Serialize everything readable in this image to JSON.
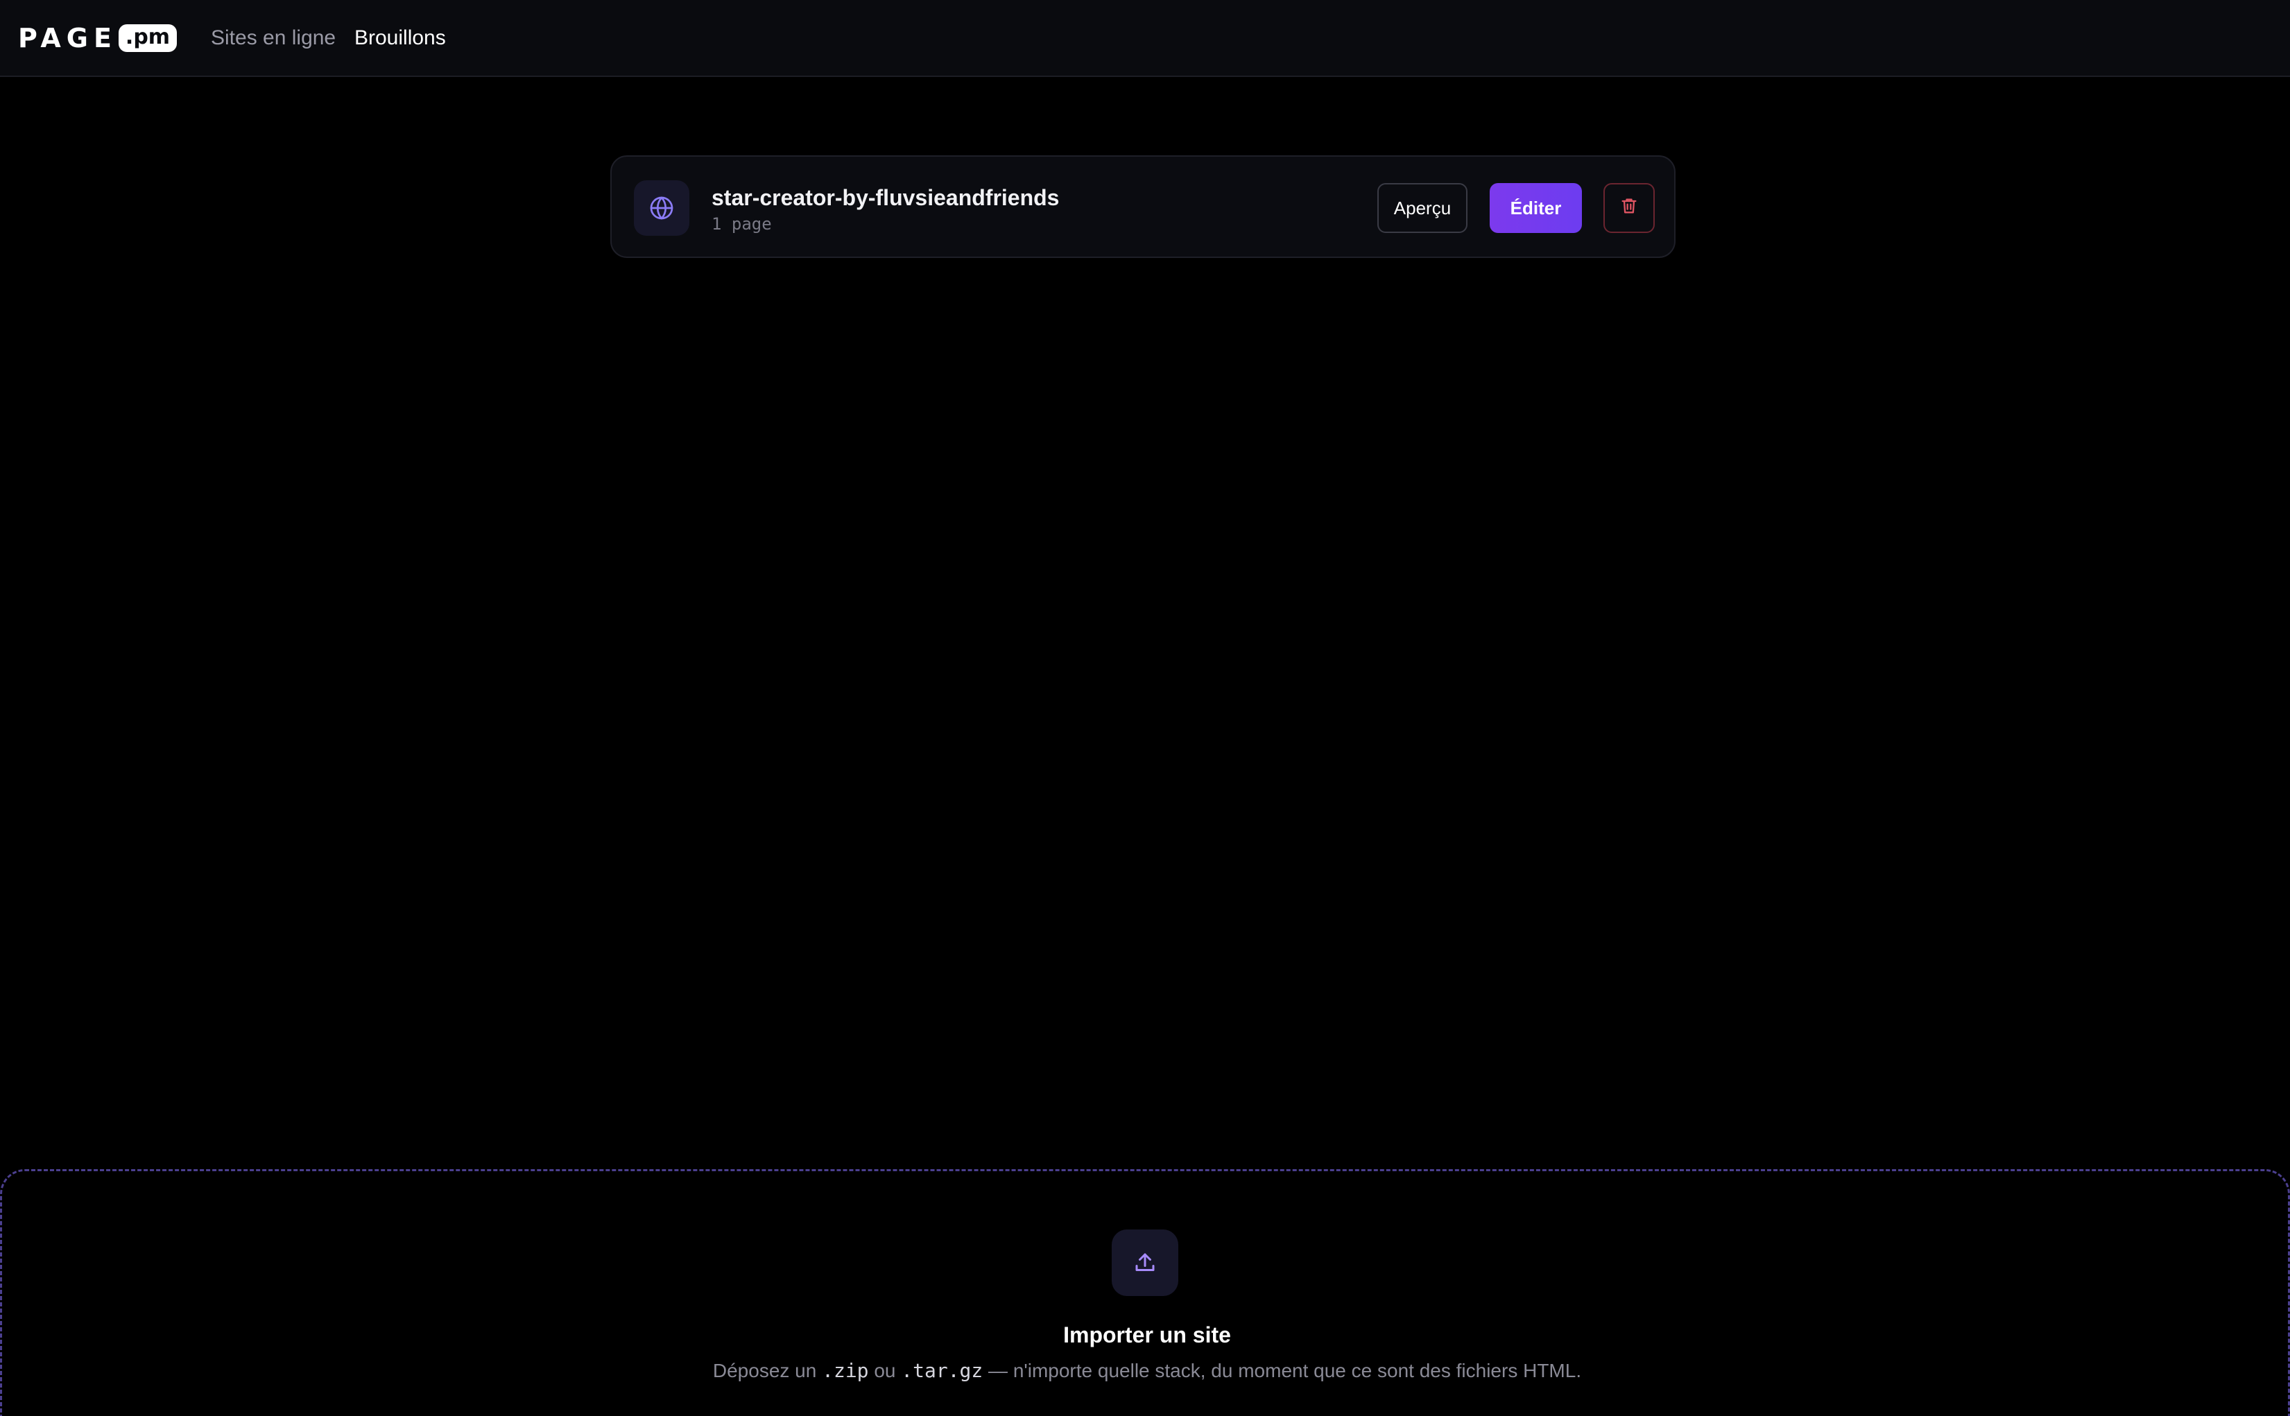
{
  "header": {
    "logo_word": "PAGE",
    "logo_badge": ".pm",
    "nav": [
      {
        "label": "Sites en ligne",
        "active": false
      },
      {
        "label": "Brouillons",
        "active": true
      }
    ]
  },
  "drafts": [
    {
      "icon": "globe-icon",
      "name": "star-creator-by-fluvsieandfriends",
      "pages": "1 page",
      "preview_label": "Aperçu",
      "edit_label": "Éditer",
      "delete_icon": "trash-icon"
    }
  ],
  "import": {
    "icon": "upload-icon",
    "title": "Importer un site",
    "desc_1": "Déposez un ",
    "ext_zip": ".zip",
    "desc_2": " ou ",
    "ext_targz": ".tar.gz",
    "desc_3": " — n'importe quelle stack, du moment que ce sont des fichiers HTML."
  },
  "colors": {
    "background": "#000000",
    "accent": "#7c3aed",
    "danger": "#e05563",
    "muted_text": "#8a8a96"
  }
}
